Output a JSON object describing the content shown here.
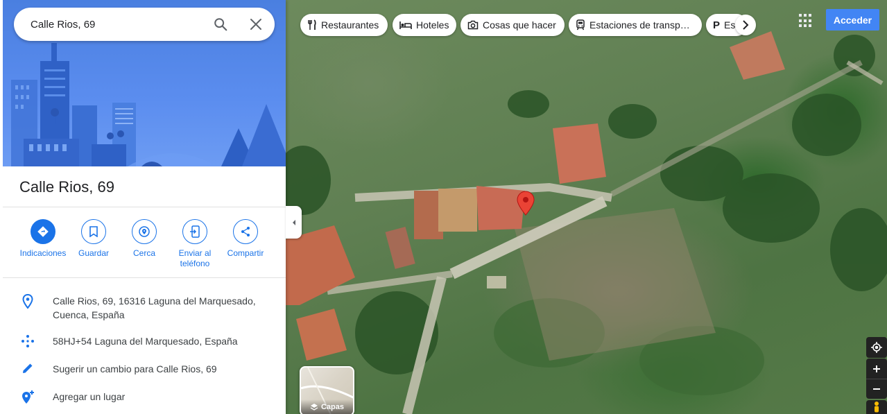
{
  "search": {
    "value": "Calle Rios, 69"
  },
  "place": {
    "title": "Calle Rios, 69"
  },
  "actions": [
    {
      "label": "Indicaciones"
    },
    {
      "label": "Guardar"
    },
    {
      "label": "Cerca"
    },
    {
      "label": "Enviar al teléfono"
    },
    {
      "label": "Compartir"
    }
  ],
  "info": {
    "address": "Calle Rios, 69, 16316 Laguna del Marquesado, Cuenca, España",
    "plus_code": "58HJ+54 Laguna del Marquesado, España",
    "suggest_edit": "Sugerir un cambio para Calle Rios, 69",
    "add_place": "Agregar un lugar"
  },
  "chips": [
    {
      "label": "Restaurantes",
      "icon": "fork-knife-icon"
    },
    {
      "label": "Hoteles",
      "icon": "bed-icon"
    },
    {
      "label": "Cosas que hacer",
      "icon": "camera-icon"
    },
    {
      "label": "Estaciones de transp…",
      "icon": "train-icon"
    },
    {
      "label": "Es",
      "icon": "parking-icon"
    }
  ],
  "header": {
    "signin_label": "Acceder"
  },
  "layers": {
    "label": "Capas"
  },
  "colors": {
    "accent": "#1a73e8",
    "pin": "#ea4335",
    "signin": "#4285f4"
  }
}
